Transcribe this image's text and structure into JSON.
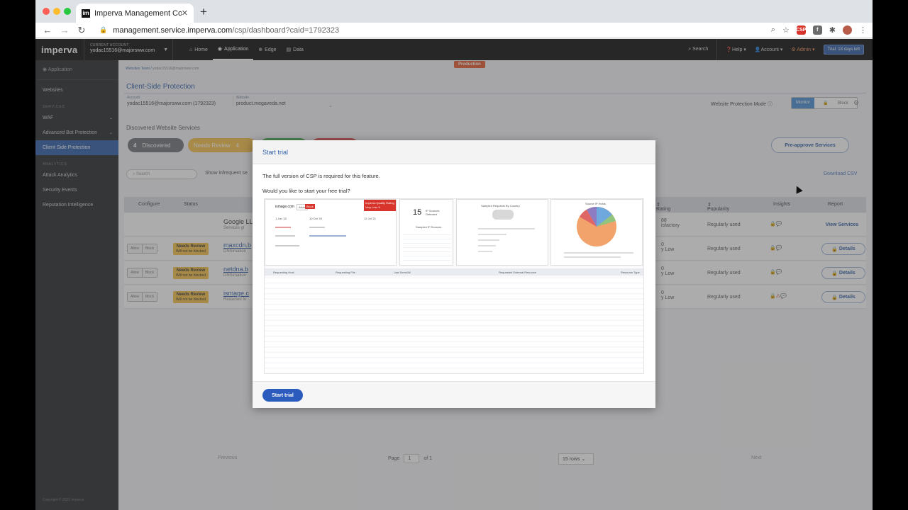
{
  "browser": {
    "tab_title": "Imperva Management Console",
    "tab_favicon": "im",
    "url_host": "management.service.imperva.com",
    "url_path": "/csp/dashboard?caid=1792323"
  },
  "header": {
    "logo": "imperva",
    "account_label": "CURRENT ACCOUNT",
    "account_value": "yodac15516@majorsww.com",
    "nav": [
      "Home",
      "Application",
      "Edge",
      "Data"
    ],
    "search": "Search",
    "help": "Help",
    "account_menu": "Account",
    "admin": "Admin",
    "trial": "Trial: 18 days left"
  },
  "sidebar": {
    "app": "Application",
    "websites": "Websites",
    "services_title": "SERVICES",
    "waf": "WAF",
    "bot": "Advanced Bot Protection",
    "csp": "Client Side Protection",
    "analytics_title": "ANALYTICS",
    "attack": "Attack Analytics",
    "security": "Security Events",
    "reputation": "Reputation Intelligence",
    "footer": "Copyright © 2021 Imperva"
  },
  "main": {
    "crumb_root": "Websites Team",
    "crumb_current": "yodac15516@majorsww.com",
    "production": "Production",
    "title": "Client-Side Protection",
    "account_label": "Account",
    "account_value": "yodac15516@majorsww.com (1792323)",
    "website_label": "Website",
    "website_value": "product.megaveda.net",
    "mode_label": "Website Protection Mode",
    "mode_on": "Monitor",
    "mode_off": "Block",
    "section": "Discovered Website Services",
    "discovered_count": "4",
    "discovered": "Discovered",
    "needs_review": "Needs Review",
    "needs_review_count": "4",
    "preapprove": "Pre-approve Services",
    "search_placeholder": "Search",
    "show_infrequent": "Show infrequent se",
    "download": "Download CSV",
    "columns": {
      "configure": "Configure",
      "status": "Status",
      "rating": "Rating",
      "popularity": "Popularity",
      "insights": "Insights",
      "report": "Report"
    },
    "rows": [
      {
        "name": "Google LL",
        "sub": "Services gl",
        "status": "",
        "status_sub": "",
        "rating": "88",
        "rating_sub": "isfactory",
        "popularity": "Regularly used",
        "action": "View Services"
      },
      {
        "name": "maxcdn.b",
        "sub": "DNSimation",
        "status": "Needs Review",
        "status_sub": "Will not be blocked",
        "rating": "0",
        "rating_sub": "y Low",
        "popularity": "Regularly used",
        "action": "Details"
      },
      {
        "name": "netdna.b",
        "sub": "DNSimation",
        "status": "Needs Review",
        "status_sub": "Will not be blocked",
        "rating": "0",
        "rating_sub": "y Low",
        "popularity": "Regularly used",
        "action": "Details"
      },
      {
        "name": "ismage.c",
        "sub": "Redacted fo",
        "status": "Needs Review",
        "status_sub": "Will not be blocked",
        "rating": "0",
        "rating_sub": "y Low",
        "popularity": "Regularly used",
        "action": "Details"
      }
    ],
    "allow": "Allow",
    "block": "Block",
    "previous": "Previous",
    "page_label": "Page",
    "page_value": "1",
    "of_label": "of 1",
    "rows_select": "15 rows",
    "next": "Next"
  },
  "modal": {
    "title": "Start trial",
    "line1": "The full version of CSP is required for this feature.",
    "line2": "Would you like to start your free trial?",
    "button": "Start trial",
    "preview": {
      "domain": "ismage.com",
      "allow": "Allow",
      "block": "Block",
      "rating": "Imperva Quality Rating",
      "rating_value": "Very Low: 0",
      "jun": "1 Jun '20",
      "oct": "10 Oct '20",
      "jul": "12 Jul '21",
      "sources_num": "15",
      "sources_lbl": "IP Sources Detected",
      "sample_ip": "Sampled IP Sources",
      "country": "Sampled Requests By Country",
      "source_ip_title": "Source IP Hosts",
      "table_headers": [
        "Requesting Host",
        "Requesting File",
        "Last Seen/All",
        "Requested External Resource",
        "Resource Type"
      ]
    }
  },
  "colors": {
    "brand_blue": "#2f5ea8",
    "production": "#e3592f",
    "needs_review": "#f6c04a",
    "approved": "#4caf50",
    "blocked": "#d9534f",
    "discovered": "#6f747a"
  }
}
